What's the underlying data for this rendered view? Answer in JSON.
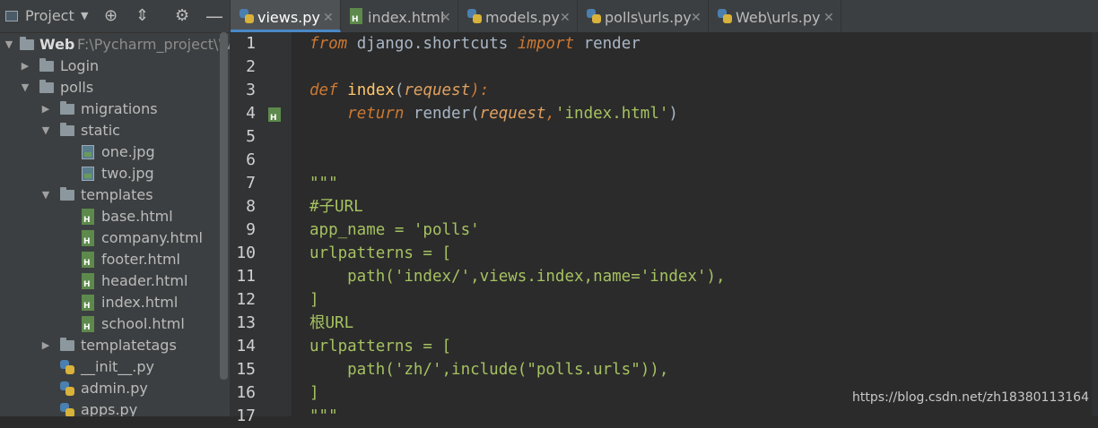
{
  "project_toolbar": {
    "label": "Project"
  },
  "tree": [
    {
      "label": "Web",
      "path": "F:\\Pycharm_project\\We",
      "type": "folder",
      "expanded": true,
      "depth": 0
    },
    {
      "label": "Login",
      "type": "folder",
      "expanded": false,
      "depth": 1
    },
    {
      "label": "polls",
      "type": "folder",
      "expanded": true,
      "depth": 1
    },
    {
      "label": "migrations",
      "type": "folder",
      "expanded": false,
      "depth": 2
    },
    {
      "label": "static",
      "type": "folder",
      "expanded": true,
      "depth": 2
    },
    {
      "label": "one.jpg",
      "type": "image",
      "depth": 3
    },
    {
      "label": "two.jpg",
      "type": "image",
      "depth": 3
    },
    {
      "label": "templates",
      "type": "folder",
      "expanded": true,
      "depth": 2
    },
    {
      "label": "base.html",
      "type": "html",
      "depth": 3
    },
    {
      "label": "company.html",
      "type": "html",
      "depth": 3
    },
    {
      "label": "footer.html",
      "type": "html",
      "depth": 3
    },
    {
      "label": "header.html",
      "type": "html",
      "depth": 3
    },
    {
      "label": "index.html",
      "type": "html",
      "depth": 3
    },
    {
      "label": "school.html",
      "type": "html",
      "depth": 3
    },
    {
      "label": "templatetags",
      "type": "folder",
      "expanded": false,
      "depth": 2
    },
    {
      "label": "__init__.py",
      "type": "python",
      "depth": 2
    },
    {
      "label": "admin.py",
      "type": "python",
      "depth": 2
    },
    {
      "label": "apps.py",
      "type": "python",
      "depth": 2
    }
  ],
  "tabs": [
    {
      "label": "views.py",
      "icon": "python-icon",
      "active": true
    },
    {
      "label": "index.html",
      "icon": "html-icon",
      "active": false
    },
    {
      "label": "models.py",
      "icon": "python-icon",
      "active": false
    },
    {
      "label": "polls\\urls.py",
      "icon": "python-icon",
      "active": false
    },
    {
      "label": "Web\\urls.py",
      "icon": "python-icon",
      "active": false
    }
  ],
  "editor": {
    "line_numbers": [
      "1",
      "2",
      "3",
      "4",
      "5",
      "6",
      "7",
      "8",
      "9",
      "10",
      "11",
      "12",
      "13",
      "14",
      "15",
      "16",
      "17"
    ],
    "lines": [
      [
        {
          "t": "from",
          "c": "kw"
        },
        {
          "t": " django.shortcuts ",
          "c": "plain"
        },
        {
          "t": "import",
          "c": "kw"
        },
        {
          "t": " render",
          "c": "plain"
        }
      ],
      [],
      [
        {
          "t": "def",
          "c": "kw"
        },
        {
          "t": " ",
          "c": "plain"
        },
        {
          "t": "index",
          "c": "fn"
        },
        {
          "t": "(",
          "c": "plain"
        },
        {
          "t": "request",
          "c": "param"
        },
        {
          "t": "):",
          "c": "kwd"
        }
      ],
      [
        {
          "t": "    ",
          "c": "plain"
        },
        {
          "t": "return",
          "c": "kw"
        },
        {
          "t": " render(",
          "c": "plain"
        },
        {
          "t": "request",
          "c": "param"
        },
        {
          "t": ",",
          "c": "kwd"
        },
        {
          "t": "'index.html'",
          "c": "strl"
        },
        {
          "t": ")",
          "c": "plain"
        }
      ],
      [],
      [],
      [
        {
          "t": "\"\"\"",
          "c": "strl"
        }
      ],
      [
        {
          "t": "#子URL",
          "c": "strl"
        }
      ],
      [
        {
          "t": "app_name = 'polls'",
          "c": "strl"
        }
      ],
      [
        {
          "t": "urlpatterns = [",
          "c": "strl"
        }
      ],
      [
        {
          "t": "    path('index/',views.index,name='index'),",
          "c": "strl"
        }
      ],
      [
        {
          "t": "]",
          "c": "strl"
        }
      ],
      [
        {
          "t": "根URL",
          "c": "strl"
        }
      ],
      [
        {
          "t": "urlpatterns = [",
          "c": "strl"
        }
      ],
      [
        {
          "t": "    path('zh/',include(\"polls.urls\")),",
          "c": "strl"
        }
      ],
      [
        {
          "t": "]",
          "c": "strl"
        }
      ],
      [
        {
          "t": "\"\"\"",
          "c": "strl"
        }
      ]
    ]
  },
  "watermark": "https://blog.csdn.net/zh18380113164",
  "colors": {
    "keyword": "#cc7832",
    "function": "#ffc66d",
    "string": "#a5c261",
    "default": "#a9b7c6",
    "accent": "#4a88c7"
  }
}
